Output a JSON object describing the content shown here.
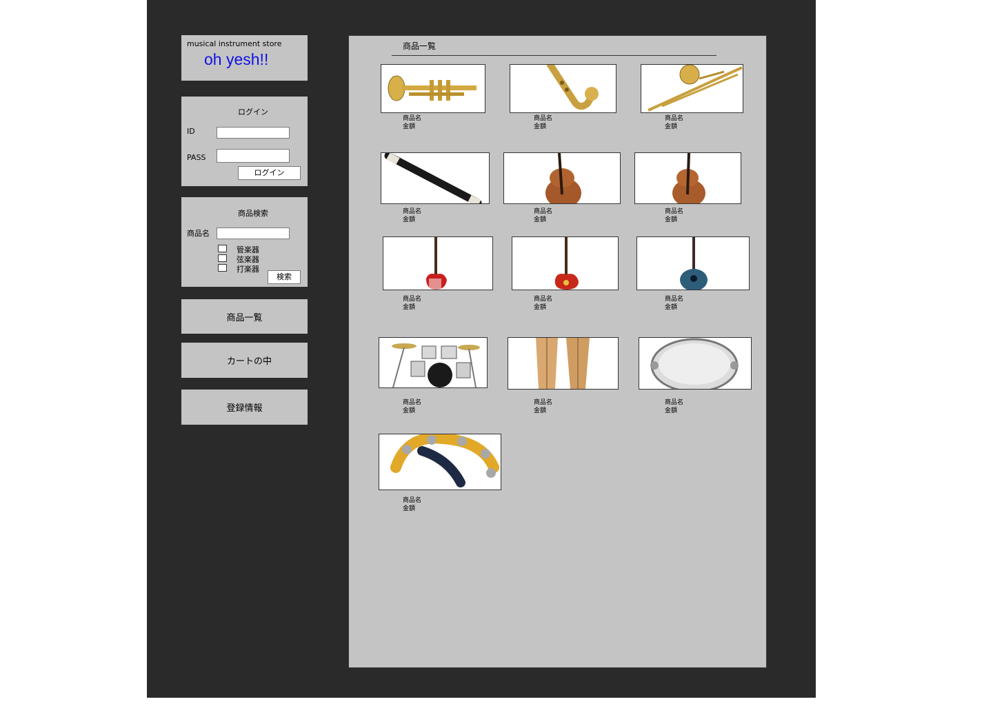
{
  "brand": {
    "store_label": "musical instrument store",
    "logo": "oh yesh!!",
    "logo_color": "#1010e6"
  },
  "login": {
    "title": "ログイン",
    "id_label": "ID",
    "id_value": "",
    "pass_label": "PASS",
    "pass_value": "",
    "button_label": "ログイン"
  },
  "search": {
    "title": "商品検索",
    "name_label": "商品名",
    "name_value": "",
    "categories": [
      {
        "label": "管楽器",
        "checked": false
      },
      {
        "label": "弦楽器",
        "checked": false
      },
      {
        "label": "打楽器",
        "checked": false
      }
    ],
    "button_label": "検索"
  },
  "nav": {
    "product_list": "商品一覧",
    "cart": "カートの中",
    "registration": "登録情報"
  },
  "main": {
    "heading": "商品一覧",
    "products": [
      {
        "icon": "trumpet-image",
        "name": "商品名",
        "price": "金額"
      },
      {
        "icon": "saxophone-image",
        "name": "商品名",
        "price": "金額"
      },
      {
        "icon": "trombone-image",
        "name": "商品名",
        "price": "金額"
      },
      {
        "icon": "recorder-image",
        "name": "商品名",
        "price": "金額"
      },
      {
        "icon": "cello-image",
        "name": "商品名",
        "price": "金額"
      },
      {
        "icon": "violin-image",
        "name": "商品名",
        "price": "金額"
      },
      {
        "icon": "electric-bass-image",
        "name": "商品名",
        "price": "金額"
      },
      {
        "icon": "electric-guitar-image",
        "name": "商品名",
        "price": "金額"
      },
      {
        "icon": "acoustic-guitar-image",
        "name": "商品名",
        "price": "金額"
      },
      {
        "icon": "drum-kit-image",
        "name": "商品名",
        "price": "金額"
      },
      {
        "icon": "conga-drums-image",
        "name": "商品名",
        "price": "金額"
      },
      {
        "icon": "tambourine-image",
        "name": "商品名",
        "price": "金額"
      },
      {
        "icon": "hand-tambourine-image",
        "name": "商品名",
        "price": "金額"
      }
    ]
  }
}
